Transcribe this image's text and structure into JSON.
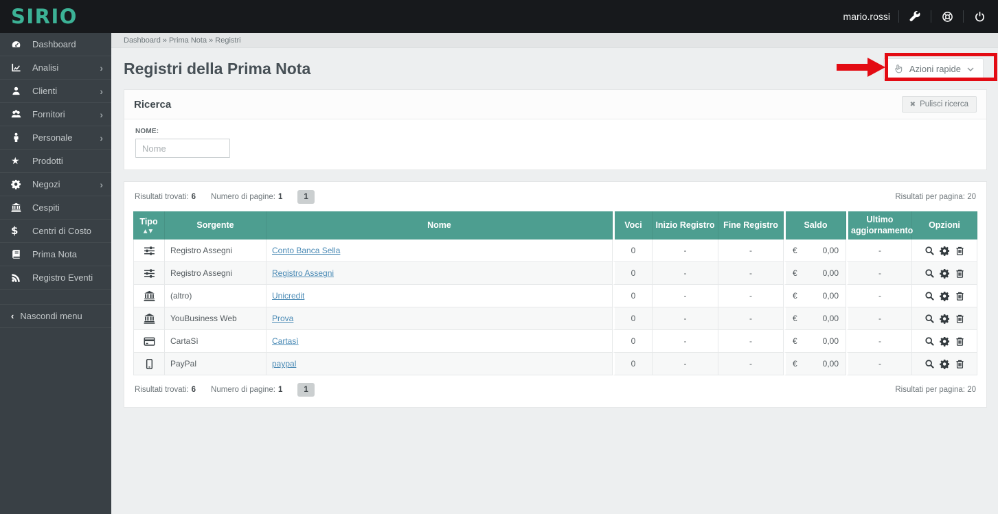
{
  "brand": {
    "name": "SIRIO"
  },
  "topbar": {
    "username": "mario.rossi"
  },
  "sidebar": {
    "items": [
      {
        "label": "Dashboard",
        "icon": "dashboard-icon",
        "expandable": false
      },
      {
        "label": "Analisi",
        "icon": "line-chart-icon",
        "expandable": true
      },
      {
        "label": "Clienti",
        "icon": "user-icon",
        "expandable": true
      },
      {
        "label": "Fornitori",
        "icon": "users-icon",
        "expandable": true
      },
      {
        "label": "Personale",
        "icon": "person-icon",
        "expandable": true
      },
      {
        "label": "Prodotti",
        "icon": "star-icon",
        "expandable": false
      },
      {
        "label": "Negozi",
        "icon": "gear-icon",
        "expandable": true
      },
      {
        "label": "Cespiti",
        "icon": "bank-icon",
        "expandable": false
      },
      {
        "label": "Centri di Costo",
        "icon": "dollar-icon",
        "expandable": false
      },
      {
        "label": "Prima Nota",
        "icon": "book-icon",
        "expandable": false
      },
      {
        "label": "Registro Eventi",
        "icon": "rss-icon",
        "expandable": false
      }
    ],
    "collapse_label": "Nascondi menu"
  },
  "breadcrumb": {
    "text": "Dashboard » Prima Nota » Registri"
  },
  "page": {
    "title": "Registri della Prima Nota"
  },
  "quick_actions": {
    "label": "Azioni rapide"
  },
  "search": {
    "title": "Ricerca",
    "clear_label": "Pulisci ricerca",
    "name_label": "NOME:",
    "name_placeholder": "Nome",
    "name_value": ""
  },
  "pagination": {
    "found_label": "Risultati trovati:",
    "found": "6",
    "pages_label": "Numero di pagine:",
    "pages": "1",
    "current_page": "1",
    "per_page_label": "Risultati per pagina:",
    "per_page": "20"
  },
  "table": {
    "headers": {
      "tipo": "Tipo",
      "sorgente": "Sorgente",
      "nome": "Nome",
      "voci": "Voci",
      "inizio": "Inizio Registro",
      "fine": "Fine Registro",
      "saldo": "Saldo",
      "ultimo": "Ultimo aggiornamento",
      "opzioni": "Opzioni"
    },
    "rows": [
      {
        "tipo_icon": "sliders-icon",
        "sorgente": "Registro Assegni",
        "nome": "Conto Banca Sella",
        "voci": "0",
        "inizio": "-",
        "fine": "-",
        "currency": "€",
        "saldo": "0,00",
        "ultimo": "-"
      },
      {
        "tipo_icon": "sliders-icon",
        "sorgente": "Registro Assegni",
        "nome": "Registro Assegni",
        "voci": "0",
        "inizio": "-",
        "fine": "-",
        "currency": "€",
        "saldo": "0,00",
        "ultimo": "-"
      },
      {
        "tipo_icon": "bank-icon",
        "sorgente": "(altro)",
        "nome": "Unicredit",
        "voci": "0",
        "inizio": "-",
        "fine": "-",
        "currency": "€",
        "saldo": "0,00",
        "ultimo": "-"
      },
      {
        "tipo_icon": "bank-icon",
        "sorgente": "YouBusiness Web",
        "nome": "Prova",
        "voci": "0",
        "inizio": "-",
        "fine": "-",
        "currency": "€",
        "saldo": "0,00",
        "ultimo": "-"
      },
      {
        "tipo_icon": "credit-card-icon",
        "sorgente": "CartaSì",
        "nome": "Cartasì",
        "voci": "0",
        "inizio": "-",
        "fine": "-",
        "currency": "€",
        "saldo": "0,00",
        "ultimo": "-"
      },
      {
        "tipo_icon": "mobile-icon",
        "sorgente": "PayPal",
        "nome": "paypal",
        "voci": "0",
        "inizio": "-",
        "fine": "-",
        "currency": "€",
        "saldo": "0,00",
        "ultimo": "-"
      }
    ]
  },
  "glyphs": {
    "chevron_right": "›",
    "chevron_left": "‹",
    "sort_asc": "▲",
    "sort_desc": "▼",
    "clear_x": "✖",
    "star": "★",
    "dollar": "$"
  },
  "colors": {
    "accent_teal": "#4d9e90",
    "brand_teal": "#3cb296",
    "annotation_red": "#e30b13",
    "link_blue": "#4a8ab5",
    "topbar_bg": "#17191c",
    "sidebar_bg": "#394045"
  }
}
